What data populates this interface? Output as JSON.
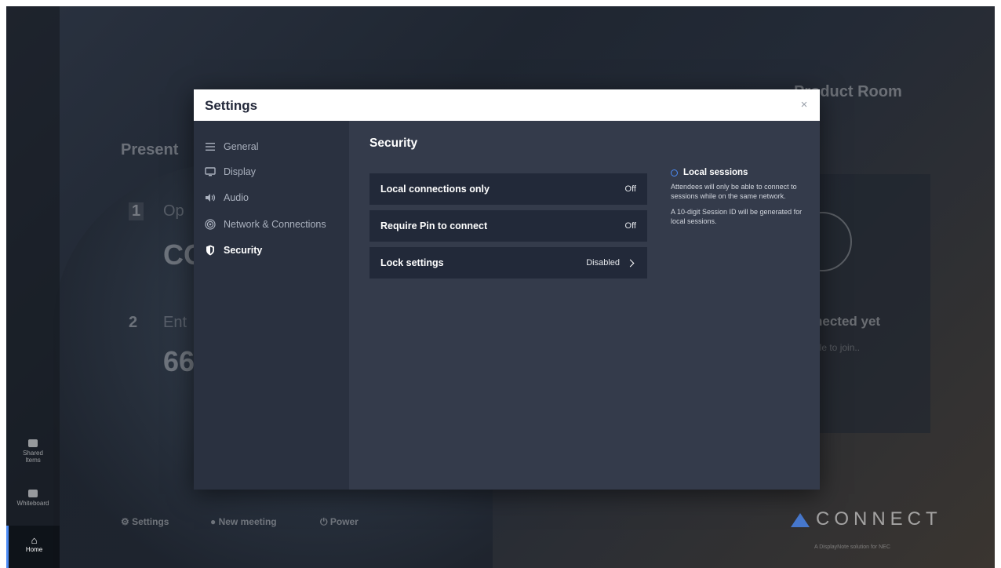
{
  "background": {
    "present_heading": "Present",
    "step1_num": "1",
    "step1_text": "Op",
    "step1_code": "co",
    "step2_num": "2",
    "step2_text": "Ent",
    "step2_code": "66",
    "room_name": "Product Room",
    "connected_text": "nected yet",
    "join_text": "ple to join.."
  },
  "left_rail": {
    "shared_items": "Shared Items",
    "whiteboard": "Whiteboard",
    "home": "Home"
  },
  "footer": {
    "settings": "Settings",
    "new_meeting": "New meeting",
    "power": "Power",
    "brand": "CONNECT",
    "brand_sub": "A DisplayNote solution for NEC"
  },
  "modal": {
    "title": "Settings",
    "close_symbol": "×",
    "nav": [
      {
        "label": "General",
        "icon": "list-icon"
      },
      {
        "label": "Display",
        "icon": "monitor-icon"
      },
      {
        "label": "Audio",
        "icon": "speaker-icon"
      },
      {
        "label": "Network & Connections",
        "icon": "signal-icon"
      },
      {
        "label": "Security",
        "icon": "shield-icon",
        "active": true
      }
    ],
    "section_title": "Security",
    "rows": [
      {
        "label": "Local connections only",
        "value": "Off"
      },
      {
        "label": "Require Pin to connect",
        "value": "Off"
      },
      {
        "label": "Lock settings",
        "value": "Disabled"
      }
    ],
    "info": {
      "title": "Local sessions",
      "para1": "Attendees will only be able to connect to sessions while on the same network.",
      "para2": "A 10-digit Session ID will be generated for local sessions."
    }
  },
  "colors": {
    "accent": "#4c8bf5",
    "nav_bg": "#2a3140",
    "content_bg": "#343b4b",
    "row_bg": "#222939"
  }
}
